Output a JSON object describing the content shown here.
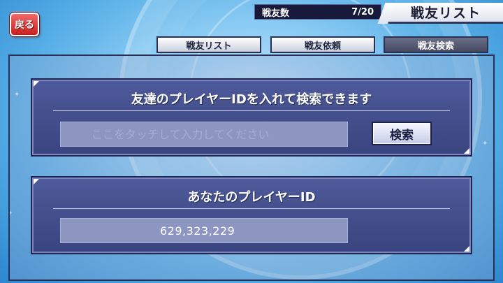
{
  "header": {
    "back_label": "戻る",
    "counter_label": "戦友数",
    "counter_value": "7/20",
    "title": "戦友リスト"
  },
  "tabs": [
    {
      "label": "戦友リスト",
      "active": false
    },
    {
      "label": "戦友依頼",
      "active": false
    },
    {
      "label": "戦友検索",
      "active": true
    }
  ],
  "search_panel": {
    "title": "友達のプレイヤーIDを入れて検索できます",
    "input_placeholder": "ここをタッチして入力してください",
    "input_value": "",
    "button_label": "検索"
  },
  "id_panel": {
    "title": "あなたのプレイヤーID",
    "player_id": "629,323,229"
  }
}
